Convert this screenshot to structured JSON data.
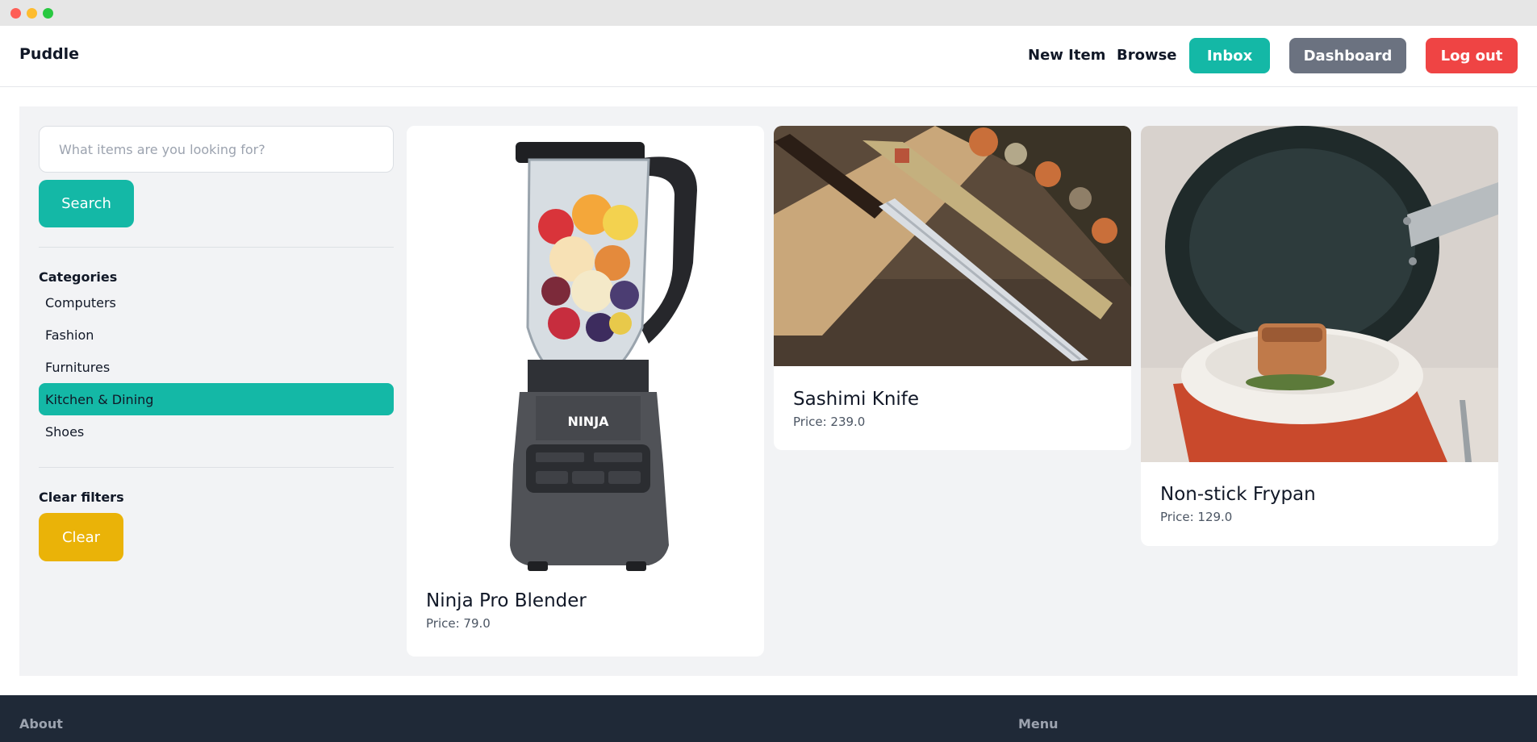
{
  "nav": {
    "brand": "Puddle",
    "new_item": "New Item",
    "browse": "Browse",
    "inbox": "Inbox",
    "dashboard": "Dashboard",
    "logout": "Log out"
  },
  "colors": {
    "accent": "#14b8a6",
    "dashboard": "#6b7280",
    "logout": "#ef4444",
    "clear": "#eab308",
    "footer": "#1f2937"
  },
  "sidebar": {
    "search_placeholder": "What items are you looking for?",
    "search_button": "Search",
    "categories_title": "Categories",
    "categories": [
      {
        "label": "Computers",
        "active": false
      },
      {
        "label": "Fashion",
        "active": false
      },
      {
        "label": "Furnitures",
        "active": false
      },
      {
        "label": "Kitchen & Dining",
        "active": true
      },
      {
        "label": "Shoes",
        "active": false
      }
    ],
    "clear_title": "Clear filters",
    "clear_button": "Clear"
  },
  "items": [
    {
      "name": "Ninja Pro Blender",
      "price": "Price: 79.0",
      "icon": "blender-image"
    },
    {
      "name": "Sashimi Knife",
      "price": "Price: 239.0",
      "icon": "knife-image"
    },
    {
      "name": "Non-stick Frypan",
      "price": "Price: 129.0",
      "icon": "frypan-image"
    }
  ],
  "footer": {
    "about": "About",
    "menu": "Menu"
  }
}
